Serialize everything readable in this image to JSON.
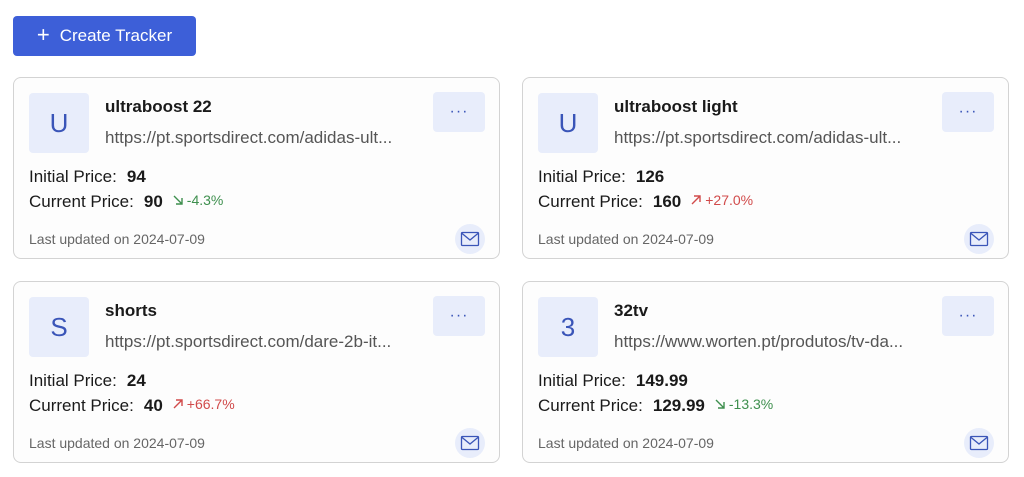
{
  "toolbar": {
    "create_label": "Create Tracker"
  },
  "labels": {
    "initial_price": "Initial Price:",
    "current_price": "Current Price:"
  },
  "colors": {
    "accent": "#3d5fd8",
    "avatar_bg": "#e8edfb",
    "price_down": "#3e8f4e",
    "price_up": "#d14b4b"
  },
  "trackers": [
    {
      "avatar_letter": "U",
      "name": "ultraboost 22",
      "url": "https://pt.sportsdirect.com/adidas-ult...",
      "initial_price": "94",
      "current_price": "90",
      "change": "-4.3%",
      "trend": "down",
      "updated": "Last updated on 2024-07-09"
    },
    {
      "avatar_letter": "U",
      "name": "ultraboost light",
      "url": "https://pt.sportsdirect.com/adidas-ult...",
      "initial_price": "126",
      "current_price": "160",
      "change": "+27.0%",
      "trend": "up",
      "updated": "Last updated on 2024-07-09"
    },
    {
      "avatar_letter": "S",
      "name": "shorts",
      "url": "https://pt.sportsdirect.com/dare-2b-it...",
      "initial_price": "24",
      "current_price": "40",
      "change": "+66.7%",
      "trend": "up",
      "updated": "Last updated on 2024-07-09"
    },
    {
      "avatar_letter": "3",
      "name": "32tv",
      "url": "https://www.worten.pt/produtos/tv-da...",
      "initial_price": "149.99",
      "current_price": "129.99",
      "change": "-13.3%",
      "trend": "down",
      "updated": "Last updated on 2024-07-09"
    }
  ]
}
